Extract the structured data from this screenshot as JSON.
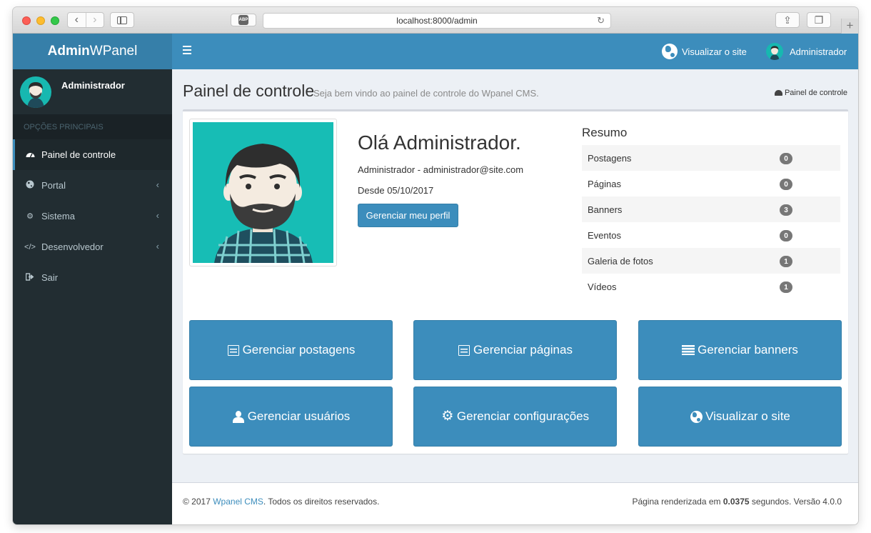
{
  "browser": {
    "url": "localhost:8000/admin",
    "abp_label": "ABP"
  },
  "brand": {
    "bold": "Admin",
    "light": "WPanel"
  },
  "sidebar": {
    "user_name": "Administrador",
    "section_header": "OPÇÕES PRINCIPAIS",
    "items": [
      {
        "label": "Painel de controle",
        "icon": "dashboard-icon",
        "active": true
      },
      {
        "label": "Portal",
        "icon": "globe-icon",
        "has_submenu": true
      },
      {
        "label": "Sistema",
        "icon": "gears-icon",
        "has_submenu": true
      },
      {
        "label": "Desenvolvedor",
        "icon": "code-icon",
        "has_submenu": true
      },
      {
        "label": "Sair",
        "icon": "sign-out-icon"
      }
    ]
  },
  "topbar": {
    "view_site": "Visualizar o site",
    "user": "Administrador"
  },
  "header": {
    "title": "Painel de controle",
    "subtitle": "Seja bem vindo ao painel de controle do Wpanel CMS.",
    "breadcrumb": "Painel de controle"
  },
  "profile": {
    "greeting": "Olá Administrador.",
    "identity": "Administrador - administrador@site.com",
    "since": "Desde 05/10/2017",
    "manage_button": "Gerenciar meu perfil"
  },
  "summary": {
    "title": "Resumo",
    "rows": [
      {
        "label": "Postagens",
        "count": "0"
      },
      {
        "label": "Páginas",
        "count": "0"
      },
      {
        "label": "Banners",
        "count": "3"
      },
      {
        "label": "Eventos",
        "count": "0"
      },
      {
        "label": "Galeria de fotos",
        "count": "1"
      },
      {
        "label": "Vídeos",
        "count": "1"
      }
    ]
  },
  "tiles": [
    {
      "label": "Gerenciar postagens",
      "icon": "list-icon"
    },
    {
      "label": "Gerenciar páginas",
      "icon": "list-icon"
    },
    {
      "label": "Gerenciar banners",
      "icon": "bars-icon"
    },
    {
      "label": "Gerenciar usuários",
      "icon": "user-icon"
    },
    {
      "label": "Gerenciar configurações",
      "icon": "gear-icon"
    },
    {
      "label": "Visualizar o site",
      "icon": "globe-icon"
    }
  ],
  "footer": {
    "copyright_prefix": "© 2017",
    "link_text": "Wpanel CMS",
    "copyright_suffix": ". Todos os direitos reservados.",
    "render_prefix": "Página renderizada em",
    "render_time": "0.0375",
    "render_suffix": "segundos. Versão 4.0.0"
  },
  "colors": {
    "primary": "#3c8dbc",
    "sidebar_bg": "#222d32",
    "logo_bg": "#367fa9",
    "avatar_bg": "#17bdb5"
  }
}
